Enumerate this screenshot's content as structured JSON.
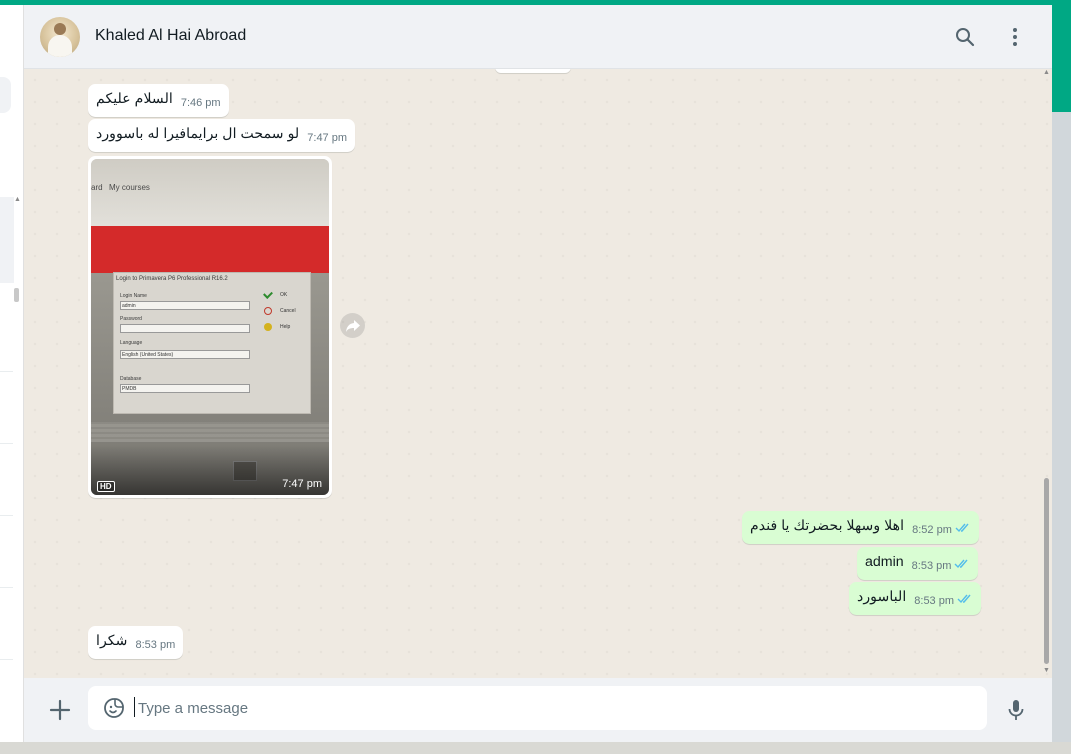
{
  "header": {
    "contact_name": "Khaled Al Hai Abroad",
    "avatar_icon": "contact-avatar",
    "search_icon": "search-icon",
    "menu_icon": "kebab-menu-icon"
  },
  "messages": [
    {
      "direction": "in",
      "text": "السلام عليكم",
      "time": "7:46 pm"
    },
    {
      "direction": "in",
      "text": "لو سمحت ال برايمافيرا له باسوورد",
      "time": "7:47 pm"
    },
    {
      "direction": "in",
      "type": "image",
      "time": "7:47 pm",
      "badge": "HD"
    },
    {
      "direction": "out",
      "text": "اهلا وسهلا بحضرتك يا فندم",
      "time": "8:52 pm",
      "status": "read"
    },
    {
      "direction": "out",
      "text": "admin",
      "time": "8:53 pm",
      "status": "read"
    },
    {
      "direction": "out",
      "text": "الباسورد",
      "time": "8:53 pm",
      "status": "read"
    },
    {
      "direction": "in",
      "text": "شكرا",
      "time": "8:53 pm"
    }
  ],
  "image_content": {
    "breadcrumb": "ard",
    "courses_link": "My courses",
    "dialog_title": "Login to Primavera P6 Professional R16.2",
    "login_name_label": "Login Name",
    "login_name_value": "admin",
    "password_label": "Password",
    "language_label": "Language",
    "language_value": "English (United States)",
    "database_label": "Database",
    "database_value": "PMDB",
    "ok_label": "OK",
    "cancel_label": "Cancel",
    "help_label": "Help"
  },
  "composer": {
    "placeholder": "Type a message",
    "attach_icon": "plus-icon",
    "emoji_icon": "emoji-sticker-icon",
    "mic_icon": "microphone-icon"
  },
  "colors": {
    "accent": "#00a884",
    "incoming_bubble": "#ffffff",
    "outgoing_bubble": "#d9fdd3",
    "chat_background": "#efeae2",
    "read_ticks": "#53bdeb"
  }
}
